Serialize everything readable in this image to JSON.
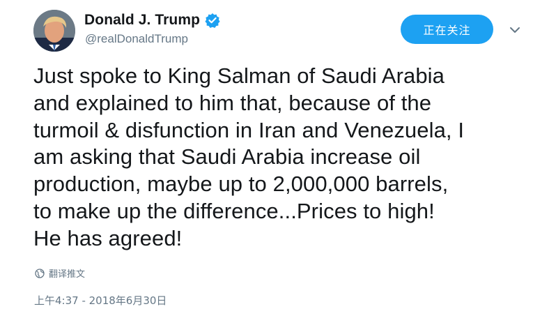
{
  "author": {
    "display_name": "Donald J. Trump",
    "handle": "@realDonaldTrump",
    "verified": true,
    "avatar_icon": "profile-photo"
  },
  "actions": {
    "follow_label": "正在关注",
    "more_icon": "chevron-down-icon"
  },
  "tweet": {
    "text": "Just spoke to King Salman of Saudi Arabia\nand explained to him that, because of the\nturmoil & disfunction in Iran and Venezuela, I\nam asking that Saudi Arabia increase oil\nproduction, maybe up to 2,000,000 barrels,\nto make up the difference...Prices to high!\nHe has agreed!",
    "translate_label": "翻译推文",
    "timestamp": "上午4:37 - 2018年6月30日"
  },
  "colors": {
    "accent": "#1da1f2",
    "text_primary": "#14171a",
    "text_secondary": "#657786"
  }
}
